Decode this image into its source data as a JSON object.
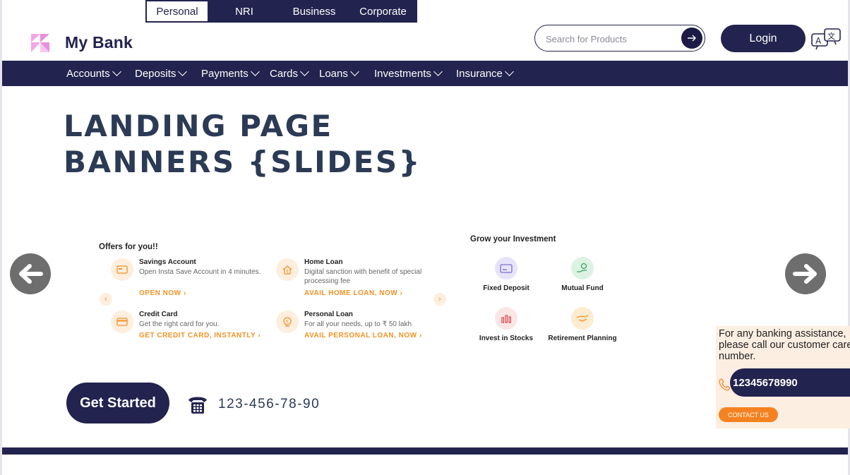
{
  "segments": [
    {
      "label": "Personal",
      "active": true
    },
    {
      "label": "NRI",
      "active": false
    },
    {
      "label": "Business",
      "active": false
    },
    {
      "label": "Corporate",
      "active": false
    }
  ],
  "brand": {
    "name": "My Bank"
  },
  "search": {
    "placeholder": "Search for Products",
    "button_icon": "arrow-right-icon"
  },
  "header": {
    "login_label": "Login",
    "language_icon": "translate-icon"
  },
  "nav": {
    "items": [
      {
        "label": "Accounts"
      },
      {
        "label": "Deposits"
      },
      {
        "label": "Payments"
      },
      {
        "label": "Cards"
      },
      {
        "label": "Loans"
      },
      {
        "label": "Investments"
      },
      {
        "label": "Insurance"
      }
    ]
  },
  "hero": {
    "heading_line1": "LANDING PAGE",
    "heading_line2": "BANNERS {SLIDES}"
  },
  "slide": {
    "offers_title": "Offers for you!!",
    "offers": [
      {
        "title": "Savings Account",
        "desc": "Open Insta Save Account in 4 minutes.",
        "link": "OPEN NOW",
        "icon": "savings-card-icon"
      },
      {
        "title": "Home Loan",
        "desc": "Digital sanction with benefit of special processing fee",
        "link": "AVAIL HOME LOAN, NOW",
        "icon": "home-loan-icon"
      },
      {
        "title": "Credit Card",
        "desc": "Get the right card for you.",
        "link": "GET CREDIT CARD, INSTANTLY",
        "icon": "credit-card-icon"
      },
      {
        "title": "Personal Loan",
        "desc": "For all your needs, up to ₹ 50 lakh",
        "link": "AVAIL PERSONAL LOAN, NOW",
        "icon": "personal-loan-icon"
      }
    ],
    "grow_title": "Grow your Investment",
    "grow_items": [
      {
        "label": "Fixed Deposit",
        "icon": "fixed-deposit-icon"
      },
      {
        "label": "Mutual Fund",
        "icon": "mutual-fund-icon"
      },
      {
        "label": "Invest in Stocks",
        "icon": "stocks-icon"
      },
      {
        "label": "Retirement Planning",
        "icon": "retirement-icon"
      }
    ],
    "mini_prev": "‹",
    "mini_next": "›",
    "link_chevron": "›"
  },
  "cta": {
    "get_started_label": "Get Started",
    "phone": "123-456-78-90"
  },
  "assist": {
    "text": "For any banking assistance, please call our customer care number.",
    "number": "12345678990",
    "contact_label": "CONTACT US"
  },
  "colors": {
    "primary": "#23234f",
    "accent": "#f39223",
    "heading": "#2b3a55",
    "panel": "#fdeee2"
  }
}
